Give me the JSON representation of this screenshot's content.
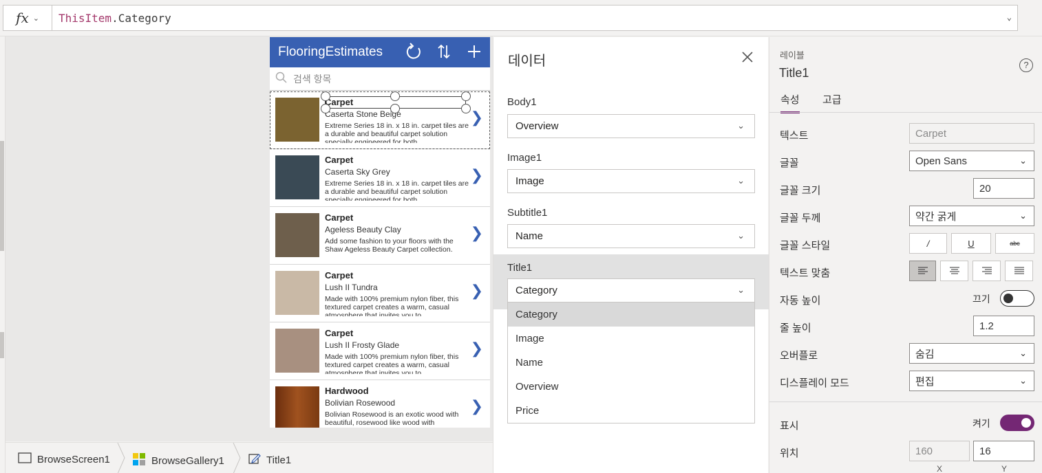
{
  "formula_bar": {
    "fx_label": "fx",
    "formula_ident": "ThisItem",
    "formula_prop": ".Category"
  },
  "app": {
    "title": "FlooringEstimates",
    "search_placeholder": "검색 항목",
    "items": [
      {
        "category": "Carpet",
        "name": "Caserta Stone Beige",
        "description": "Extreme Series 18 in. x 18 in. carpet tiles are a durable and beautiful carpet solution specially engineered for both",
        "color": "#7b6330"
      },
      {
        "category": "Carpet",
        "name": "Caserta Sky Grey",
        "description": "Extreme Series 18 in. x 18 in. carpet tiles are a durable and beautiful carpet solution specially engineered for both",
        "color": "#3a4a55"
      },
      {
        "category": "Carpet",
        "name": "Ageless Beauty Clay",
        "description": "Add some fashion to your floors with the Shaw Ageless Beauty Carpet collection.",
        "color": "#6e5f4c"
      },
      {
        "category": "Carpet",
        "name": "Lush II Tundra",
        "description": "Made with 100% premium nylon fiber, this textured carpet creates a warm, casual atmosphere that invites you to",
        "color": "#c9b9a6"
      },
      {
        "category": "Carpet",
        "name": "Lush II Frosty Glade",
        "description": "Made with 100% premium nylon fiber, this textured carpet creates a warm, casual atmosphere that invites you to",
        "color": "#a89080"
      },
      {
        "category": "Hardwood",
        "name": "Bolivian Rosewood",
        "description": "Bolivian Rosewood is an exotic wood with beautiful, rosewood like wood with",
        "color": "#8a4418"
      }
    ]
  },
  "data_panel": {
    "title": "데이터",
    "fields": [
      {
        "label": "Body1",
        "value": "Overview"
      },
      {
        "label": "Image1",
        "value": "Image"
      },
      {
        "label": "Subtitle1",
        "value": "Name"
      },
      {
        "label": "Title1",
        "value": "Category"
      }
    ],
    "options": [
      "Category",
      "Image",
      "Name",
      "Overview",
      "Price"
    ]
  },
  "properties": {
    "type_label": "레이블",
    "control_name": "Title1",
    "help": "?",
    "tabs": [
      "속성",
      "고급"
    ],
    "text_label": "텍스트",
    "text_value": "Carpet",
    "font_label": "글꼴",
    "font_value": "Open Sans",
    "font_size_label": "글꼴 크기",
    "font_size_value": "20",
    "font_weight_label": "글꼴 두께",
    "font_weight_value": "약간 굵게",
    "font_style_label": "글꼴 스타일",
    "font_style_buttons": [
      "/",
      "U",
      "abc"
    ],
    "text_align_label": "텍스트 맞춤",
    "auto_height_label": "자동 높이",
    "auto_height_state": "끄기",
    "line_height_label": "줄 높이",
    "line_height_value": "1.2",
    "overflow_label": "오버플로",
    "overflow_value": "숨김",
    "display_mode_label": "디스플레이 모드",
    "display_mode_value": "편집",
    "visible_label": "표시",
    "visible_state": "켜기",
    "position_label": "위치",
    "position_x": "160",
    "position_y": "16",
    "x_label": "X",
    "y_label": "Y",
    "accent_color": "#742774"
  },
  "breadcrumb": {
    "screen": "BrowseScreen1",
    "gallery": "BrowseGallery1",
    "control": "Title1"
  },
  "icons": [
    "fx-icon",
    "chevron-down-icon",
    "refresh-icon",
    "sort-icon",
    "add-icon",
    "search-icon",
    "chevron-right-icon",
    "close-icon",
    "help-icon",
    "screen-icon",
    "gallery-icon",
    "edit-label-icon"
  ]
}
